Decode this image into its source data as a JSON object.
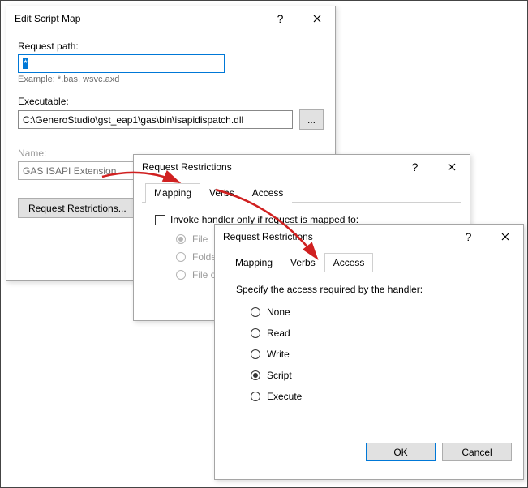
{
  "dlg1": {
    "title": "Edit Script Map",
    "request_path_label": "Request path:",
    "request_path_value": "*",
    "example": "Example: *.bas, wsvc.axd",
    "executable_label": "Executable:",
    "executable_value": "C:\\GeneroStudio\\gst_eap1\\gas\\bin\\isapidispatch.dll",
    "browse": "...",
    "name_label": "Name:",
    "name_value": "GAS ISAPI Extension",
    "restrictions_btn": "Request Restrictions..."
  },
  "dlg2": {
    "title": "Request Restrictions",
    "tabs": {
      "mapping": "Mapping",
      "verbs": "Verbs",
      "access": "Access"
    },
    "invoke_label": "Invoke handler only if request is mapped to:",
    "radio_file": "File",
    "radio_folder": "Folder",
    "radio_both": "File or folder"
  },
  "dlg3": {
    "title": "Request Restrictions",
    "tabs": {
      "mapping": "Mapping",
      "verbs": "Verbs",
      "access": "Access"
    },
    "spec_label": "Specify the access required by the handler:",
    "radios": {
      "none": "None",
      "read": "Read",
      "write": "Write",
      "script": "Script",
      "execute": "Execute"
    },
    "ok": "OK",
    "cancel": "Cancel"
  }
}
